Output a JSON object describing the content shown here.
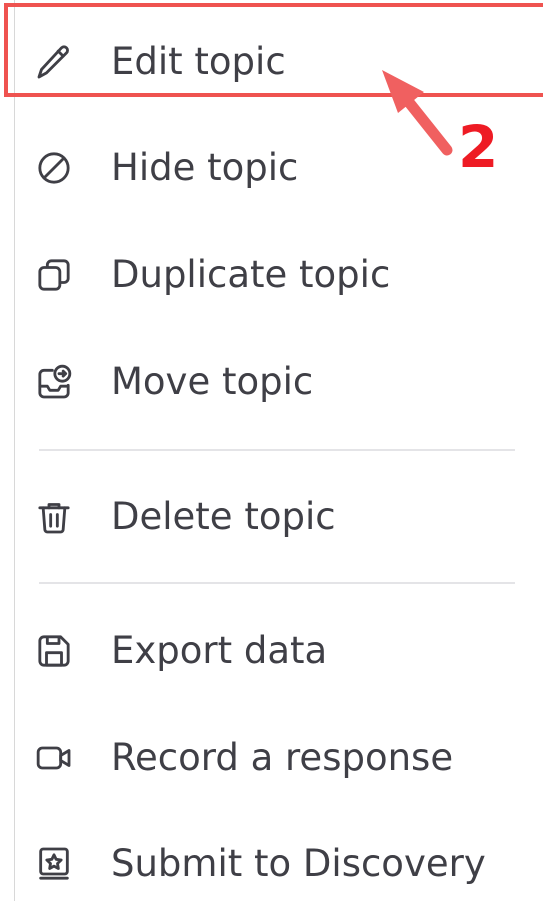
{
  "menu": {
    "items": [
      {
        "label": "Edit topic",
        "icon": "pencil-icon"
      },
      {
        "label": "Hide topic",
        "icon": "hide-icon"
      },
      {
        "label": "Duplicate topic",
        "icon": "duplicate-icon"
      },
      {
        "label": "Move topic",
        "icon": "move-icon"
      },
      {
        "label": "Delete topic",
        "icon": "trash-icon"
      },
      {
        "label": "Export data",
        "icon": "save-icon"
      },
      {
        "label": "Record a response",
        "icon": "video-camera-icon"
      },
      {
        "label": "Submit to Discovery",
        "icon": "discovery-star-icon"
      }
    ]
  },
  "annotation": {
    "step_number": "2",
    "color": "#ee1b24",
    "box_color": "#ef5350"
  },
  "colors": {
    "text": "#3f3f46",
    "divider": "#e4e4e7"
  }
}
